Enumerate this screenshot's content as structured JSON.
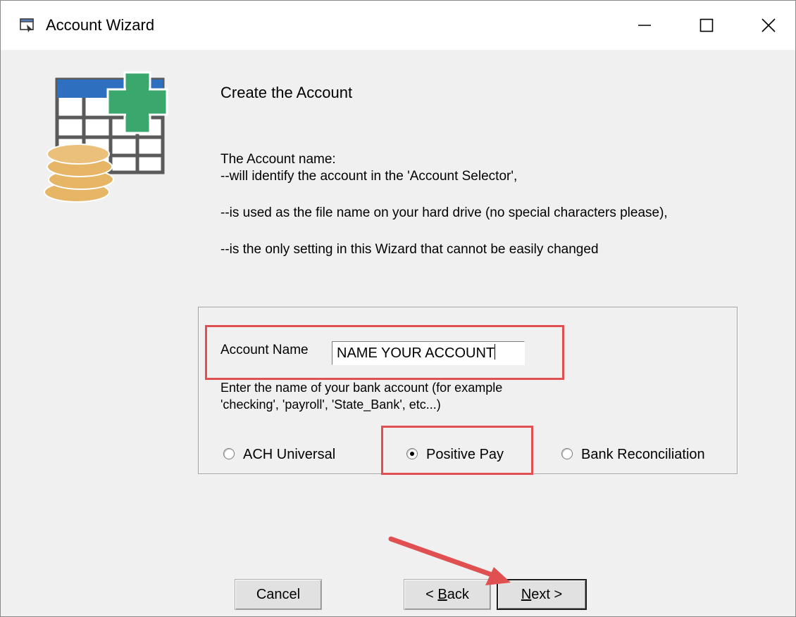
{
  "window": {
    "title": "Account Wizard"
  },
  "page": {
    "heading": "Create the Account",
    "lines": [
      "The Account name:",
      "--will identify the account in the 'Account Selector',",
      "--is used as the file name on your hard drive (no special characters please),",
      "--is the only setting in this Wizard that cannot be easily changed"
    ]
  },
  "form": {
    "account_name_label": "Account Name",
    "account_name_value": "NAME YOUR ACCOUNT",
    "hint_line1": "Enter the name of your bank account (for example",
    "hint_line2": "'checking', 'payroll', 'State_Bank', etc...)",
    "radio_options": [
      "ACH Universal",
      "Positive Pay",
      "Bank Reconciliation"
    ],
    "selected_option": "Positive Pay"
  },
  "buttons": {
    "cancel": "Cancel",
    "back_prefix": "< ",
    "back_accel": "B",
    "back_rest": "ack",
    "next_accel": "N",
    "next_rest": "ext >"
  },
  "colors": {
    "annotation_red": "#e05050",
    "icon_blue": "#2f6fbf",
    "icon_green": "#3aa76d",
    "coin_gold": "#e6b565"
  }
}
